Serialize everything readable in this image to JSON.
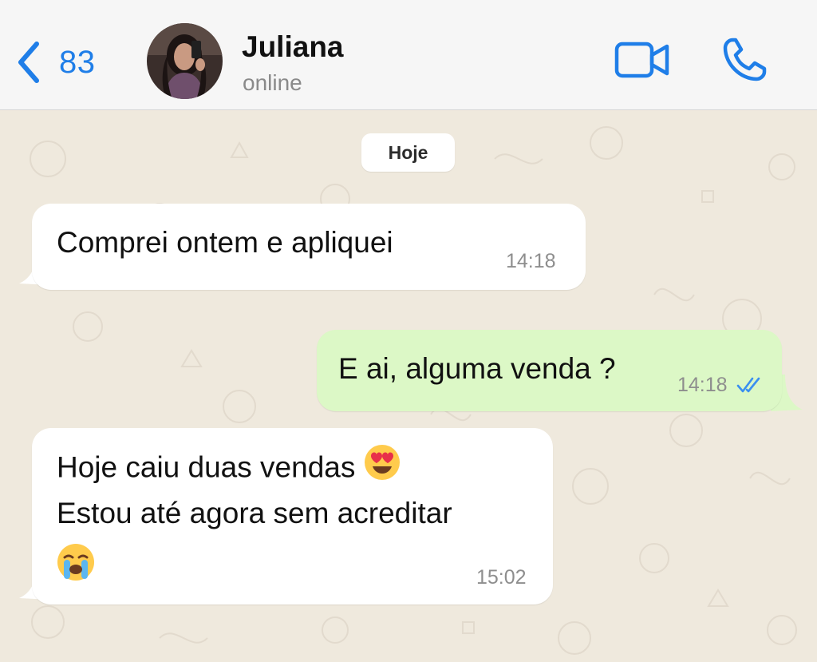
{
  "header": {
    "back_count": "83",
    "contact_name": "Juliana",
    "contact_status": "online"
  },
  "chat": {
    "date_label": "Hoje",
    "messages": [
      {
        "direction": "incoming",
        "lines": [
          "Comprei ontem e apliquei"
        ],
        "time": "14:18"
      },
      {
        "direction": "outgoing",
        "lines": [
          "E ai, alguma venda ?"
        ],
        "time": "14:18",
        "status": "read"
      },
      {
        "direction": "incoming",
        "lines": [
          "Hoje caiu duas vendas",
          "Estou até agora sem acreditar"
        ],
        "emojis": [
          "heart-eyes-emoji",
          "crying-emoji"
        ],
        "time": "15:02"
      }
    ]
  },
  "colors": {
    "accent": "#1f7ee8",
    "outgoing_bubble": "#dcf8c6",
    "incoming_bubble": "#ffffff",
    "chat_background": "#efe9dd",
    "read_ticks": "#3a8ff0"
  }
}
